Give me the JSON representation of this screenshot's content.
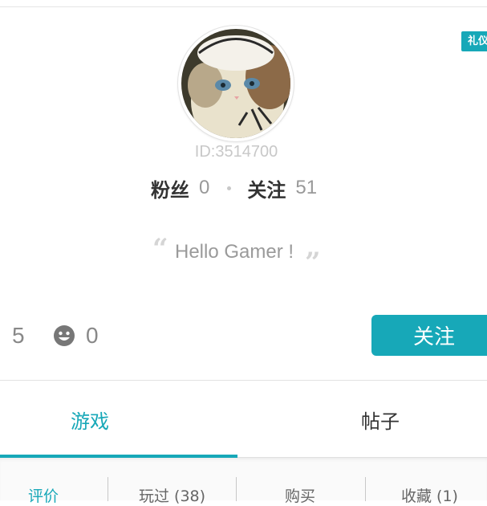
{
  "badge": {
    "label": "礼仪"
  },
  "profile": {
    "user_id": "ID:3514700",
    "fans_label": "粉丝",
    "fans_count": "0",
    "following_label": "关注",
    "following_count": "51",
    "bio": "Hello Gamer !"
  },
  "counters": {
    "left_value": "5",
    "smile_icon": "smiley-icon",
    "smile_value": "0"
  },
  "actions": {
    "follow_label": "关注"
  },
  "tabs": [
    {
      "label": "游戏",
      "active": true
    },
    {
      "label": "帖子",
      "active": false
    }
  ],
  "subtabs": [
    {
      "label": "评价",
      "active": true
    },
    {
      "label": "玩过 (38)",
      "active": false
    },
    {
      "label": "购买",
      "active": false
    },
    {
      "label": "收藏 (1)",
      "active": false
    }
  ],
  "colors": {
    "accent": "#17a8b8",
    "muted": "#999999",
    "text": "#333333"
  }
}
